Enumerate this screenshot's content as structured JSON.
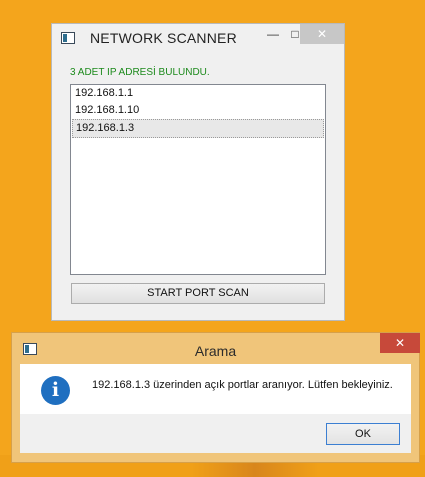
{
  "scanner_window": {
    "title": "NETWORK SCANNER",
    "min_glyph": "—",
    "max_glyph": "□",
    "close_glyph": "✕",
    "status_text": "3 ADET IP ADRESİ BULUNDU.",
    "ip_list": [
      "192.168.1.1",
      "192.168.1.10",
      "192.168.1.3"
    ],
    "selected_ip": "192.168.1.3",
    "start_button_label": "START PORT SCAN",
    "colors": {
      "status": "#1c8a1c"
    }
  },
  "dialog": {
    "title": "Arama",
    "close_glyph": "✕",
    "icon": "info-icon",
    "icon_glyph": "i",
    "message": "192.168.1.3 üzerinden açık portlar aranıyor. Lütfen bekleyiniz.",
    "ok_label": "OK",
    "colors": {
      "frame": "#f0c57a",
      "close": "#c7493a",
      "info": "#1f6fc0"
    }
  }
}
